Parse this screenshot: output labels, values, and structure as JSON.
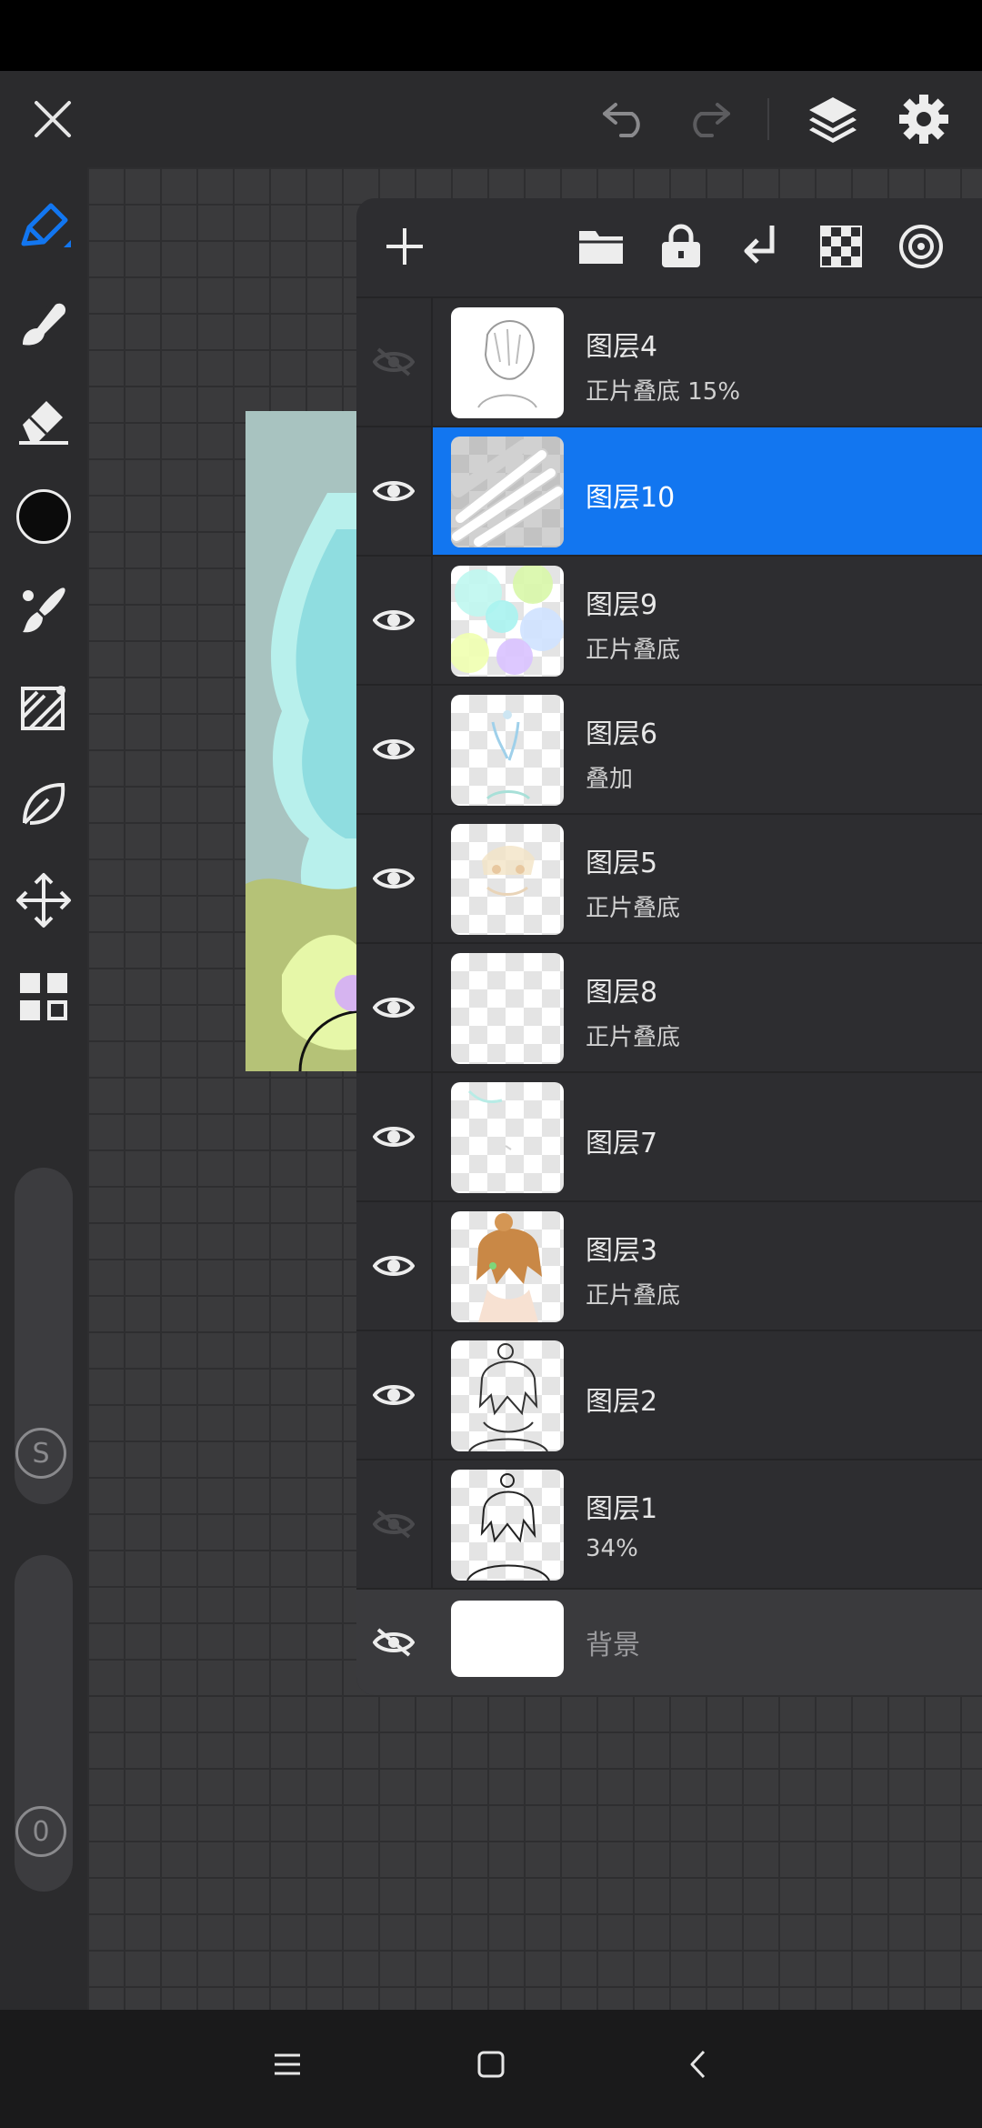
{
  "top_bar": {
    "close_icon": "close-icon",
    "undo_icon": "undo-icon",
    "redo_icon": "redo-icon",
    "layers_icon": "layers-icon",
    "settings_icon": "gear-icon"
  },
  "left_toolbar": {
    "tools": [
      "pen-tool-icon",
      "smudge-tool-icon",
      "eraser-icon",
      "color-swatch",
      "brush-icon",
      "fill-icon",
      "lasso-icon",
      "transform-icon",
      "gallery-icon"
    ],
    "current_color": "#0b0b0b",
    "accent": "#1276f0",
    "size_label": "S",
    "opacity_label": "0"
  },
  "layers_panel": {
    "header_icons": [
      "add-layer-icon",
      "folder-icon",
      "lock-icon",
      "merge-down-icon",
      "checker-icon",
      "target-icon"
    ],
    "layers": [
      {
        "name": "图层4",
        "meta": "正片叠底   15%",
        "visible": false,
        "selected": false
      },
      {
        "name": "图层10",
        "meta": "",
        "visible": true,
        "selected": true
      },
      {
        "name": "图层9",
        "meta": "正片叠底",
        "visible": true,
        "selected": false
      },
      {
        "name": "图层6",
        "meta": "叠加",
        "visible": true,
        "selected": false
      },
      {
        "name": "图层5",
        "meta": "正片叠底",
        "visible": true,
        "selected": false
      },
      {
        "name": "图层8",
        "meta": "正片叠底",
        "visible": true,
        "selected": false
      },
      {
        "name": "图层7",
        "meta": "",
        "visible": true,
        "selected": false
      },
      {
        "name": "图层3",
        "meta": "正片叠底",
        "visible": true,
        "selected": false
      },
      {
        "name": "图层2",
        "meta": "",
        "visible": true,
        "selected": false
      },
      {
        "name": "图层1",
        "meta": "34%",
        "visible": false,
        "selected": false
      }
    ],
    "background": {
      "name": "背景",
      "visible": false
    }
  },
  "nav_bar": {
    "menu_icon": "menu-icon",
    "home_icon": "home-icon",
    "back_icon": "back-icon"
  }
}
